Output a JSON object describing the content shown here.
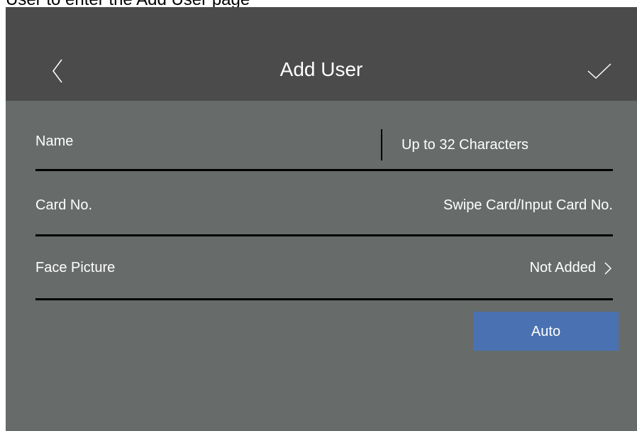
{
  "caption": "User to enter the Add User page",
  "header": {
    "title": "Add User",
    "back_icon": "chevron-left-icon",
    "confirm_icon": "checkmark-icon"
  },
  "form": {
    "name": {
      "label": "Name",
      "placeholder": "Up to 32 Characters",
      "value": ""
    },
    "card": {
      "label": "Card No.",
      "value": "Swipe Card/Input Card No."
    },
    "face": {
      "label": "Face Picture",
      "value": "Not Added",
      "icon": "chevron-right-icon"
    }
  },
  "auto_button": {
    "label": "Auto"
  },
  "colors": {
    "background": "#676c6a",
    "header": "#4b4b4b",
    "accent": "#4a72b2",
    "text": "#ffffff",
    "divider": "#000000"
  }
}
